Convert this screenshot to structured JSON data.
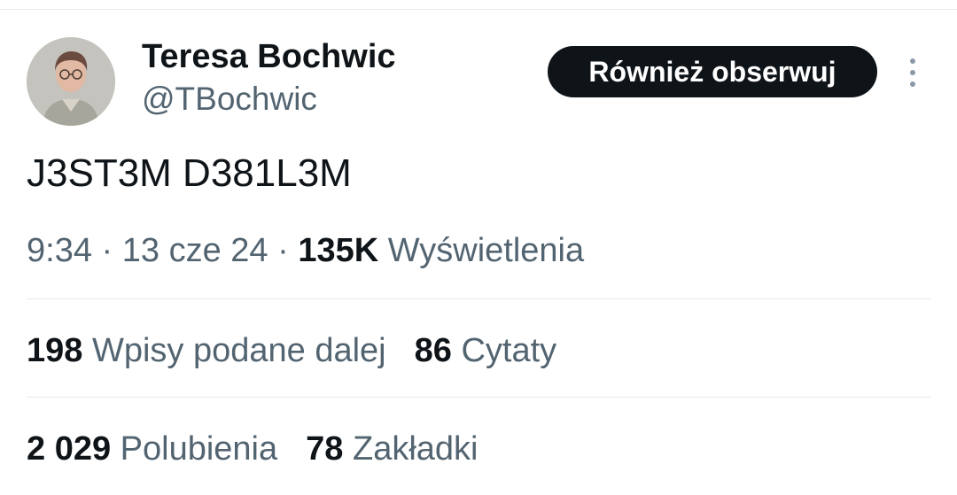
{
  "author": {
    "name": "Teresa Bochwic",
    "handle": "@TBochwic"
  },
  "follow_button": {
    "label": "Również obserwuj"
  },
  "more_button": {
    "icon": "more-vertical-icon"
  },
  "tweet": {
    "text": "J3ST3M D381L3M"
  },
  "meta": {
    "time": "9:34",
    "separator": " · ",
    "date": "13 cze 24",
    "views_count": "135K",
    "views_label": "Wyświetlenia"
  },
  "stats": {
    "reposts": {
      "count": "198",
      "label": "Wpisy podane dalej"
    },
    "quotes": {
      "count": "86",
      "label": "Cytaty"
    },
    "likes": {
      "count": "2 029",
      "label": "Polubienia"
    },
    "bookmarks": {
      "count": "78",
      "label": "Zakładki"
    }
  },
  "colors": {
    "text_primary": "#0f1419",
    "text_secondary": "#536471",
    "button_bg": "#0f1419",
    "divider": "#e6e9ec"
  }
}
